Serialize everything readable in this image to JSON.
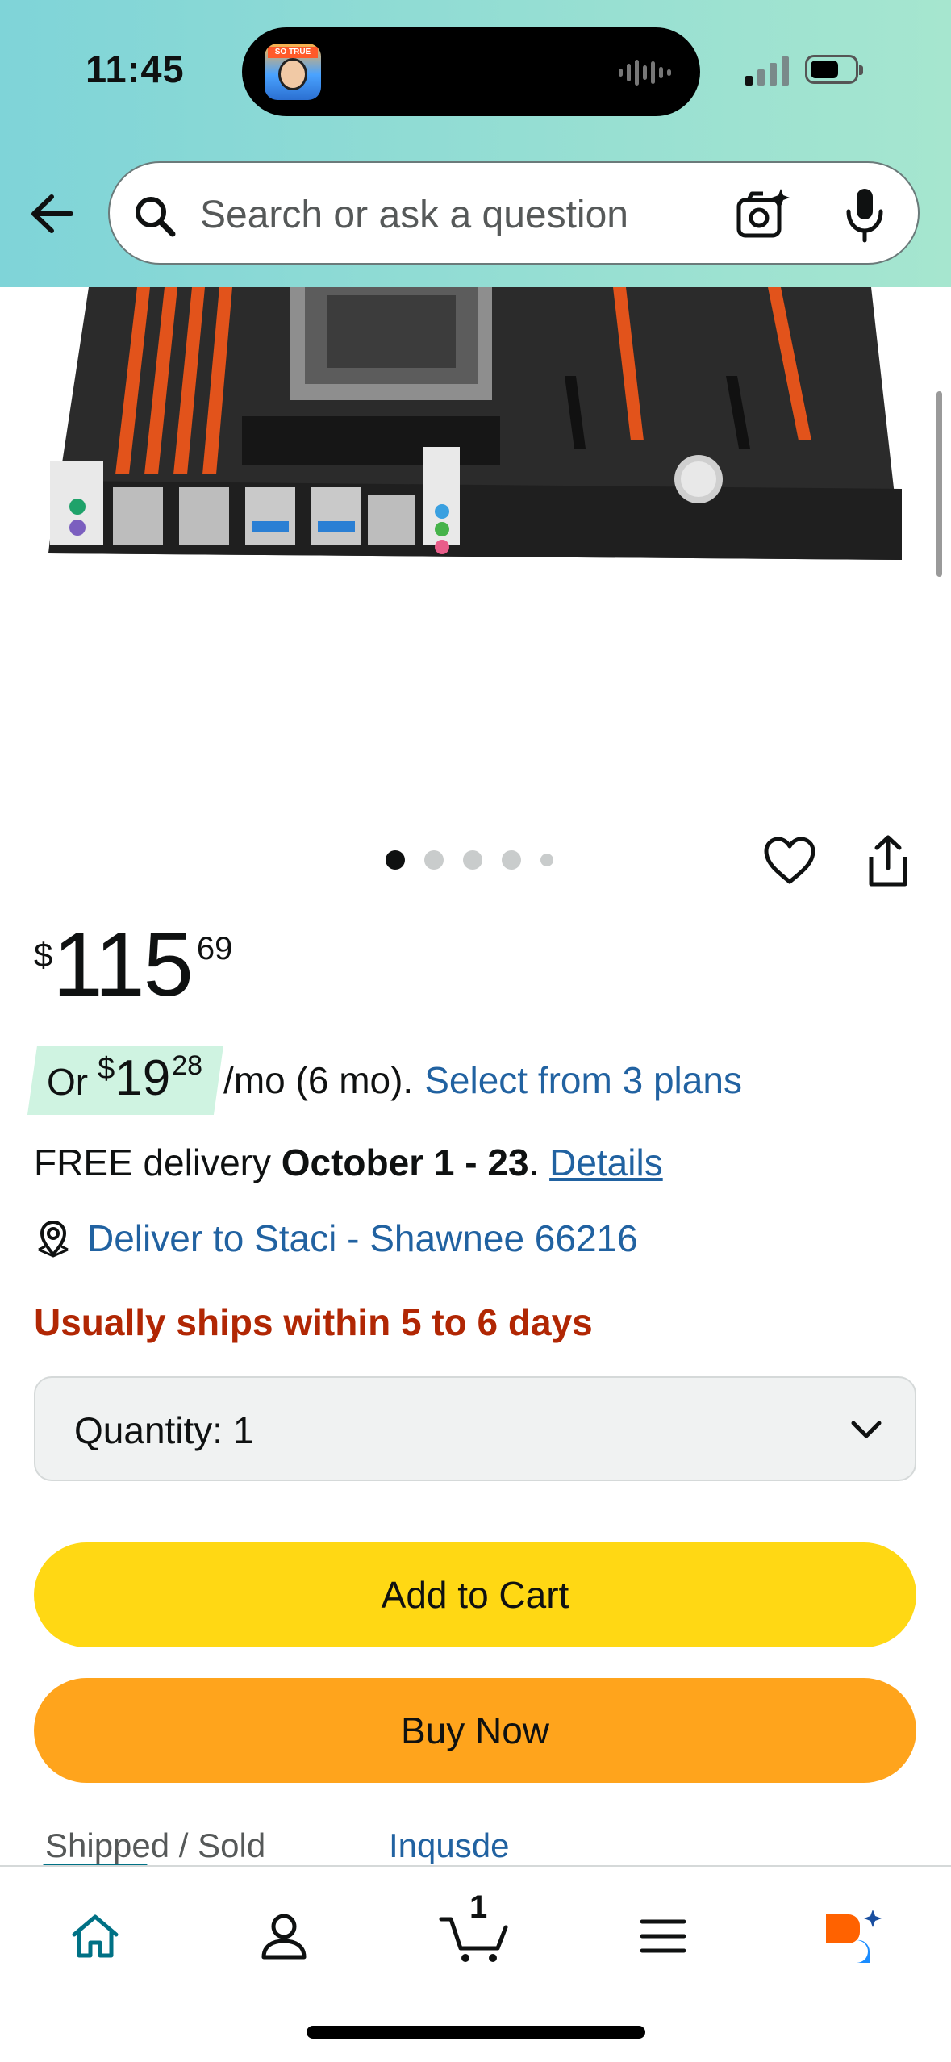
{
  "status_bar": {
    "time": "11:45",
    "thumbnail_tag": "SO TRUE"
  },
  "search": {
    "placeholder": "Search or ask a question"
  },
  "gallery": {
    "image_count": 5,
    "active_index": 0
  },
  "price": {
    "currency": "$",
    "whole": "115",
    "fraction": "69"
  },
  "installment": {
    "prefix": "Or",
    "currency": "$",
    "whole": "19",
    "fraction": "28",
    "suffix": "/mo (6 mo).",
    "link": "Select from 3 plans"
  },
  "delivery": {
    "prefix": "FREE delivery ",
    "dates": "October 1 - 23",
    "separator": ". ",
    "details_link": "Details"
  },
  "deliver_to": "Deliver to Staci - Shawnee 66216",
  "ships": "Usually ships within 5 to 6 days",
  "quantity": {
    "label": "Quantity:",
    "value": "1"
  },
  "buttons": {
    "add_to_cart": "Add to Cart",
    "buy_now": "Buy Now"
  },
  "seller_row": {
    "label": "Shipped / Sold",
    "seller": "Inqusde"
  },
  "bottom_nav": {
    "cart_count": "1"
  },
  "colors": {
    "add_to_cart": "#ffd814",
    "buy_now": "#ffa41c",
    "link": "#2162a1",
    "ships_warning": "#b12704",
    "header_left": "#7fd4d8",
    "header_right": "#a6e6cf",
    "installment_highlight": "#cff3e1",
    "active_tab": "#007185"
  }
}
